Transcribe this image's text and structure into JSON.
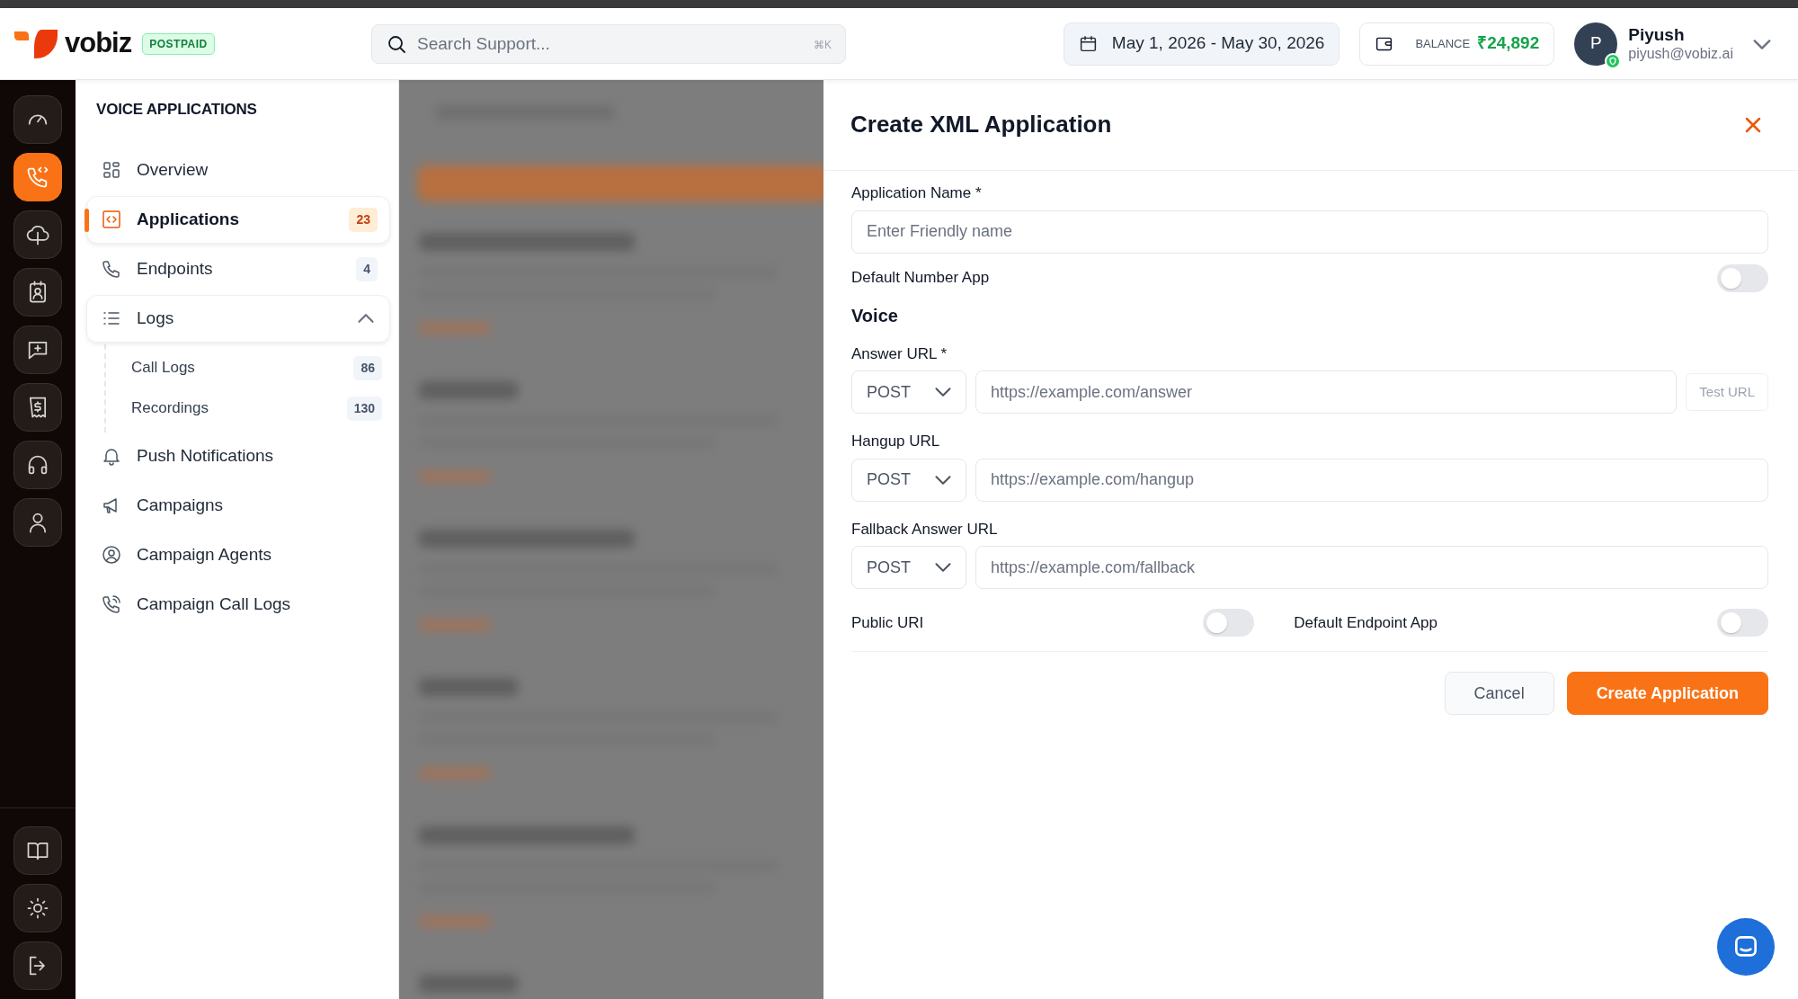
{
  "header": {
    "logo": "vobiz",
    "plan_badge": "POSTPAID",
    "search": {
      "placeholder": "Search Support...",
      "shortcut": "⌘K"
    },
    "date_range": "May 1, 2026 - May 30, 2026",
    "balance_label": "BALANCE",
    "balance": "₹24,892",
    "user": {
      "initial": "P",
      "name": "Piyush",
      "email": "piyush@vobiz.ai",
      "verified": true
    }
  },
  "rail": {
    "items": [
      {
        "kind": "gauge",
        "selected": false
      },
      {
        "kind": "phone-code",
        "selected": true
      },
      {
        "kind": "cloud",
        "selected": false
      },
      {
        "kind": "contact",
        "selected": false
      },
      {
        "kind": "message-plus",
        "selected": false
      },
      {
        "kind": "receipt",
        "selected": false
      },
      {
        "kind": "headphones",
        "selected": false
      },
      {
        "kind": "user",
        "selected": false
      }
    ],
    "bottom_items": [
      {
        "kind": "book",
        "selected": false
      },
      {
        "kind": "sun",
        "selected": false
      },
      {
        "kind": "logout",
        "selected": false
      }
    ]
  },
  "nav": {
    "title": "VOICE APPLICATIONS",
    "items": [
      {
        "label": "Overview",
        "kind": "grid",
        "selected": false
      },
      {
        "label": "Applications",
        "kind": "code-square",
        "count": "23",
        "selected": true
      },
      {
        "label": "Endpoints",
        "kind": "phone",
        "count": "4",
        "selected": false
      },
      {
        "label": "Logs",
        "kind": "list",
        "selected": false,
        "expanded": true,
        "children": [
          {
            "label": "Call Logs",
            "count": "86",
            "selected": false
          },
          {
            "label": "Recordings",
            "count": "130",
            "selected": false
          }
        ]
      },
      {
        "label": "Push Notifications",
        "kind": "bell",
        "selected": false
      },
      {
        "label": "Campaigns",
        "kind": "megaphone",
        "selected": false
      },
      {
        "label": "Campaign Agents",
        "kind": "user-circle",
        "selected": false
      },
      {
        "label": "Campaign Call Logs",
        "kind": "phone-waves",
        "selected": false
      }
    ]
  },
  "drawer": {
    "title": "Create XML Application",
    "fields": [
      {
        "kind": "text",
        "label": "Application Name *",
        "placeholder": "Enter Friendly name"
      },
      {
        "kind": "toggle",
        "label": "Default Number App",
        "on": false
      },
      {
        "kind": "heading",
        "label": "Voice"
      },
      {
        "kind": "url",
        "label": "Answer URL *",
        "method": "POST",
        "placeholder": "https://example.com/answer",
        "action": {
          "label": "Test URL",
          "disabled": true
        }
      },
      {
        "kind": "url",
        "label": "Hangup URL",
        "method": "POST",
        "placeholder": "https://example.com/hangup"
      },
      {
        "kind": "url",
        "label": "Fallback Answer URL",
        "method": "POST",
        "placeholder": "https://example.com/fallback"
      },
      {
        "kind": "toggle_pair",
        "items": [
          {
            "label": "Public URI",
            "on": false
          },
          {
            "label": "Default Endpoint App",
            "on": false
          }
        ]
      }
    ],
    "buttons": [
      {
        "label": "Cancel",
        "kind": "secondary"
      },
      {
        "label": "Create Application",
        "kind": "primary"
      }
    ]
  }
}
